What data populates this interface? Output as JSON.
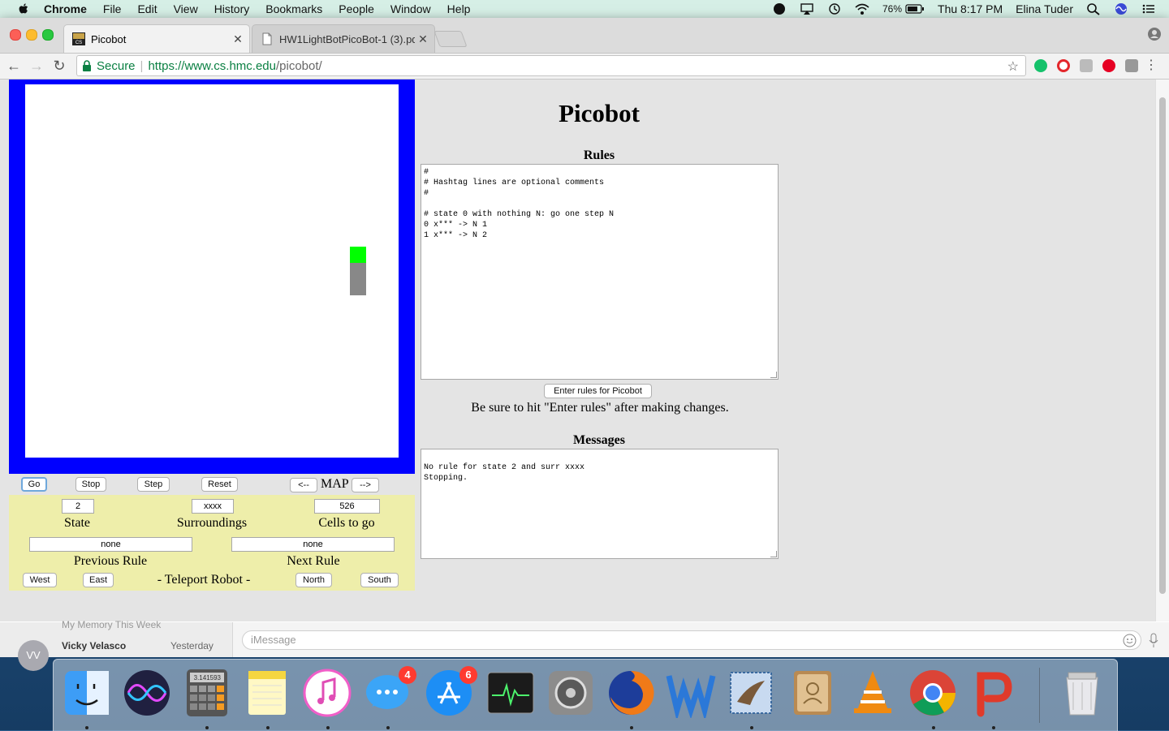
{
  "menubar": {
    "app": "Chrome",
    "items": [
      "File",
      "Edit",
      "View",
      "History",
      "Bookmarks",
      "People",
      "Window",
      "Help"
    ],
    "battery": "76%",
    "clock": "Thu 8:17 PM",
    "user": "Elina Tuder"
  },
  "browser": {
    "tabs": [
      {
        "title": "Picobot",
        "active": true,
        "favicon": "hmc-favicon"
      },
      {
        "title": "HW1LightBotPicoBot-1 (3).pd",
        "active": false,
        "favicon": "document-icon"
      }
    ],
    "secure_label": "Secure",
    "url_host": "https://www.cs.hmc.edu",
    "url_path": "/picobot/"
  },
  "picobot": {
    "title": "Picobot",
    "controls": {
      "go": "Go",
      "stop": "Stop",
      "step": "Step",
      "reset": "Reset",
      "map_prev": "<--",
      "map_label": "MAP",
      "map_next": "-->"
    },
    "status": {
      "state_value": "2",
      "state_label": "State",
      "surroundings_value": "xxxx",
      "surroundings_label": "Surroundings",
      "cells_value": "526",
      "cells_label": "Cells to go",
      "prev_rule_value": "none",
      "prev_rule_label": "Previous Rule",
      "next_rule_value": "none",
      "next_rule_label": "Next Rule"
    },
    "teleport": {
      "west": "West",
      "east": "East",
      "label": "- Teleport Robot -",
      "north": "North",
      "south": "South"
    },
    "rules_heading": "Rules",
    "rules_text": "#\n# Hashtag lines are optional comments\n#\n\n# state 0 with nothing N: go one step N\n0 x*** -> N 1\n1 x*** -> N 2",
    "enter_rules_button": "Enter rules for Picobot",
    "enter_rules_note": "Be sure to hit \"Enter rules\" after making changes.",
    "messages_heading": "Messages",
    "messages_text": "\nNo rule for state 2 and surr xxxx\nStopping.",
    "colors": {
      "wall": "#0000ff",
      "robot": "#00ff00",
      "visited": "#888888",
      "panel": "#eeeeaa"
    }
  },
  "messages_app": {
    "contact": "Vicky Velasco",
    "initials": "VV",
    "time": "Yesterday",
    "faint_preview": "My Memory This Week",
    "input_placeholder": "iMessage"
  },
  "dock": {
    "apps": [
      "finder",
      "siri",
      "calculator",
      "notes",
      "itunes",
      "messages",
      "app-store",
      "activity-monitor",
      "system-preferences",
      "firefox",
      "word",
      "mail",
      "contacts",
      "vlc",
      "chrome",
      "powerpoint",
      "trash"
    ],
    "badges": {
      "messages": "4",
      "app_store": "6"
    },
    "calculator_display": "3.141593"
  }
}
